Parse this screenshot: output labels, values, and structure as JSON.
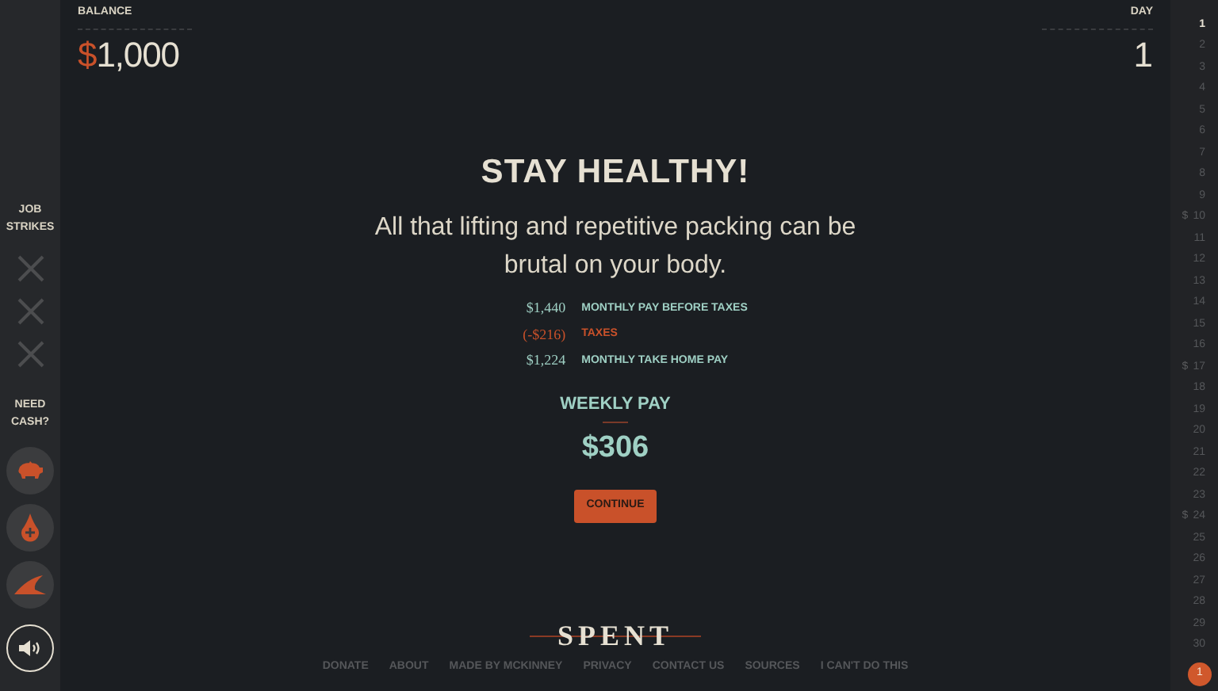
{
  "balance": {
    "label": "BALANCE",
    "currency": "$",
    "amount": "1,000"
  },
  "day": {
    "label": "DAY",
    "value": "1"
  },
  "sidebar": {
    "strikes_label": "JOB STRIKES",
    "strikes": [
      {
        "struck": false
      },
      {
        "struck": false
      },
      {
        "struck": false
      }
    ],
    "cash_label": "NEED CASH?",
    "cash_options": [
      {
        "kind": "pig"
      },
      {
        "kind": "drop"
      },
      {
        "kind": "fin"
      }
    ],
    "sound": {
      "on": true
    }
  },
  "message": {
    "title": "STAY HEALTHY!",
    "text": "All that lifting and repetitive packing can be brutal on your body.",
    "breakdown": [
      {
        "amount": "$1,440",
        "label": "MONTHLY PAY BEFORE TAXES",
        "kind": "income"
      },
      {
        "amount": "(-$216)",
        "label": "TAXES",
        "kind": "deduction"
      },
      {
        "amount": "$1,224",
        "label": "MONTHLY TAKE HOME PAY",
        "kind": "income"
      }
    ],
    "weekly_label": "WEEKLY PAY",
    "weekly_amount": "$306",
    "button": "CONTINUE"
  },
  "footer": {
    "logo": "SPENT",
    "links": [
      "DONATE",
      "ABOUT",
      "MADE BY MCKINNEY",
      "PRIVACY",
      "CONTACT US",
      "SOURCES",
      "I CAN'T DO THIS"
    ]
  },
  "calendar": {
    "days": [
      {
        "label": "1",
        "current": true
      },
      {
        "label": "2",
        "current": false
      },
      {
        "label": "3",
        "current": false
      },
      {
        "label": "4",
        "current": false
      },
      {
        "label": "5",
        "current": false
      },
      {
        "label": "6",
        "current": false
      },
      {
        "label": "7",
        "current": false
      },
      {
        "label": "8",
        "current": false
      },
      {
        "label": "9",
        "current": false
      },
      {
        "label": "10",
        "current": false,
        "mark": "$"
      },
      {
        "label": "11",
        "current": false
      },
      {
        "label": "12",
        "current": false
      },
      {
        "label": "13",
        "current": false
      },
      {
        "label": "14",
        "current": false
      },
      {
        "label": "15",
        "current": false
      },
      {
        "label": "16",
        "current": false
      },
      {
        "label": "17",
        "current": false,
        "mark": "$"
      },
      {
        "label": "18",
        "current": false
      },
      {
        "label": "19",
        "current": false
      },
      {
        "label": "20",
        "current": false
      },
      {
        "label": "21",
        "current": false
      },
      {
        "label": "22",
        "current": false
      },
      {
        "label": "23",
        "current": false
      },
      {
        "label": "24",
        "current": false,
        "mark": "$"
      },
      {
        "label": "25",
        "current": false
      },
      {
        "label": "26",
        "current": false
      },
      {
        "label": "27",
        "current": false
      },
      {
        "label": "28",
        "current": false
      },
      {
        "label": "29",
        "current": false
      },
      {
        "label": "30",
        "current": false
      }
    ],
    "badge": "1"
  }
}
